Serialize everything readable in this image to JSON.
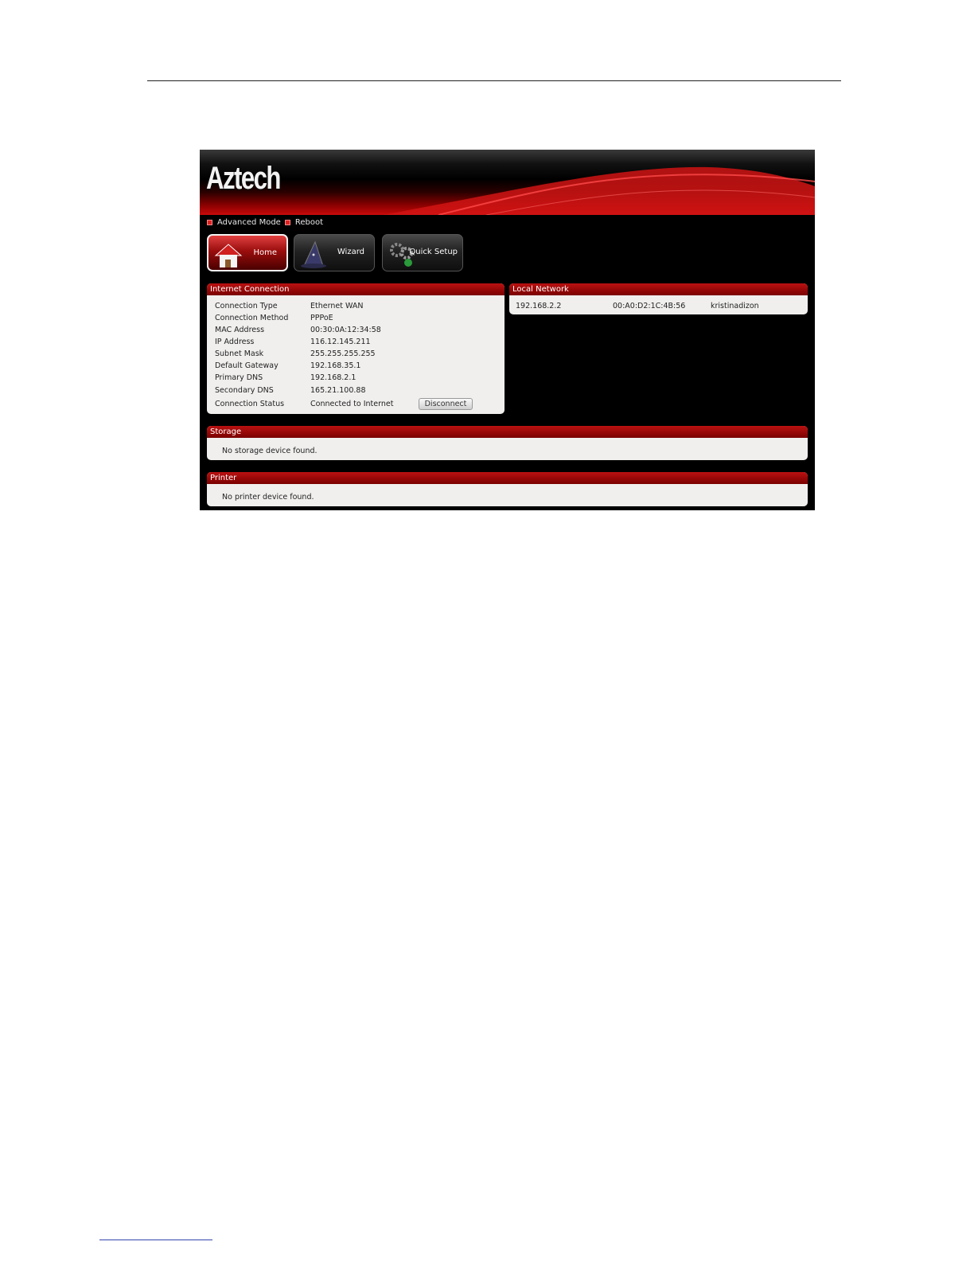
{
  "brand": {
    "name": "Aztech"
  },
  "top_links": [
    "Advanced Mode",
    "Reboot"
  ],
  "nav": [
    {
      "label": "Home",
      "icon": "house-icon",
      "active": true
    },
    {
      "label": "Wizard",
      "icon": "wizard-hat-icon",
      "active": false
    },
    {
      "label": "Quick Setup",
      "icon": "gears-icon",
      "active": false
    }
  ],
  "internet_connection": {
    "title": "Internet Connection",
    "rows": [
      {
        "label": "Connection Type",
        "value": "Ethernet WAN"
      },
      {
        "label": "Connection Method",
        "value": "PPPoE"
      },
      {
        "label": "MAC Address",
        "value": "00:30:0A:12:34:58"
      },
      {
        "label": "IP Address",
        "value": "116.12.145.211"
      },
      {
        "label": "Subnet Mask",
        "value": "255.255.255.255"
      },
      {
        "label": "Default Gateway",
        "value": "192.168.35.1"
      },
      {
        "label": "Primary DNS",
        "value": "192.168.2.1"
      },
      {
        "label": "Secondary DNS",
        "value": "165.21.100.88"
      },
      {
        "label": "Connection Status",
        "value": "Connected to Internet"
      }
    ],
    "disconnect_label": "Disconnect"
  },
  "local_network": {
    "title": "Local Network",
    "devices": [
      {
        "ip": "192.168.2.2",
        "mac": "00:A0:D2:1C:4B:56",
        "name": "kristinadizon"
      }
    ]
  },
  "storage": {
    "title": "Storage",
    "message": "No storage device found."
  },
  "printer": {
    "title": "Printer",
    "message": "No printer device found."
  },
  "colors": {
    "accent": "#b01010",
    "panel": "#f0efee",
    "background": "#000000"
  }
}
